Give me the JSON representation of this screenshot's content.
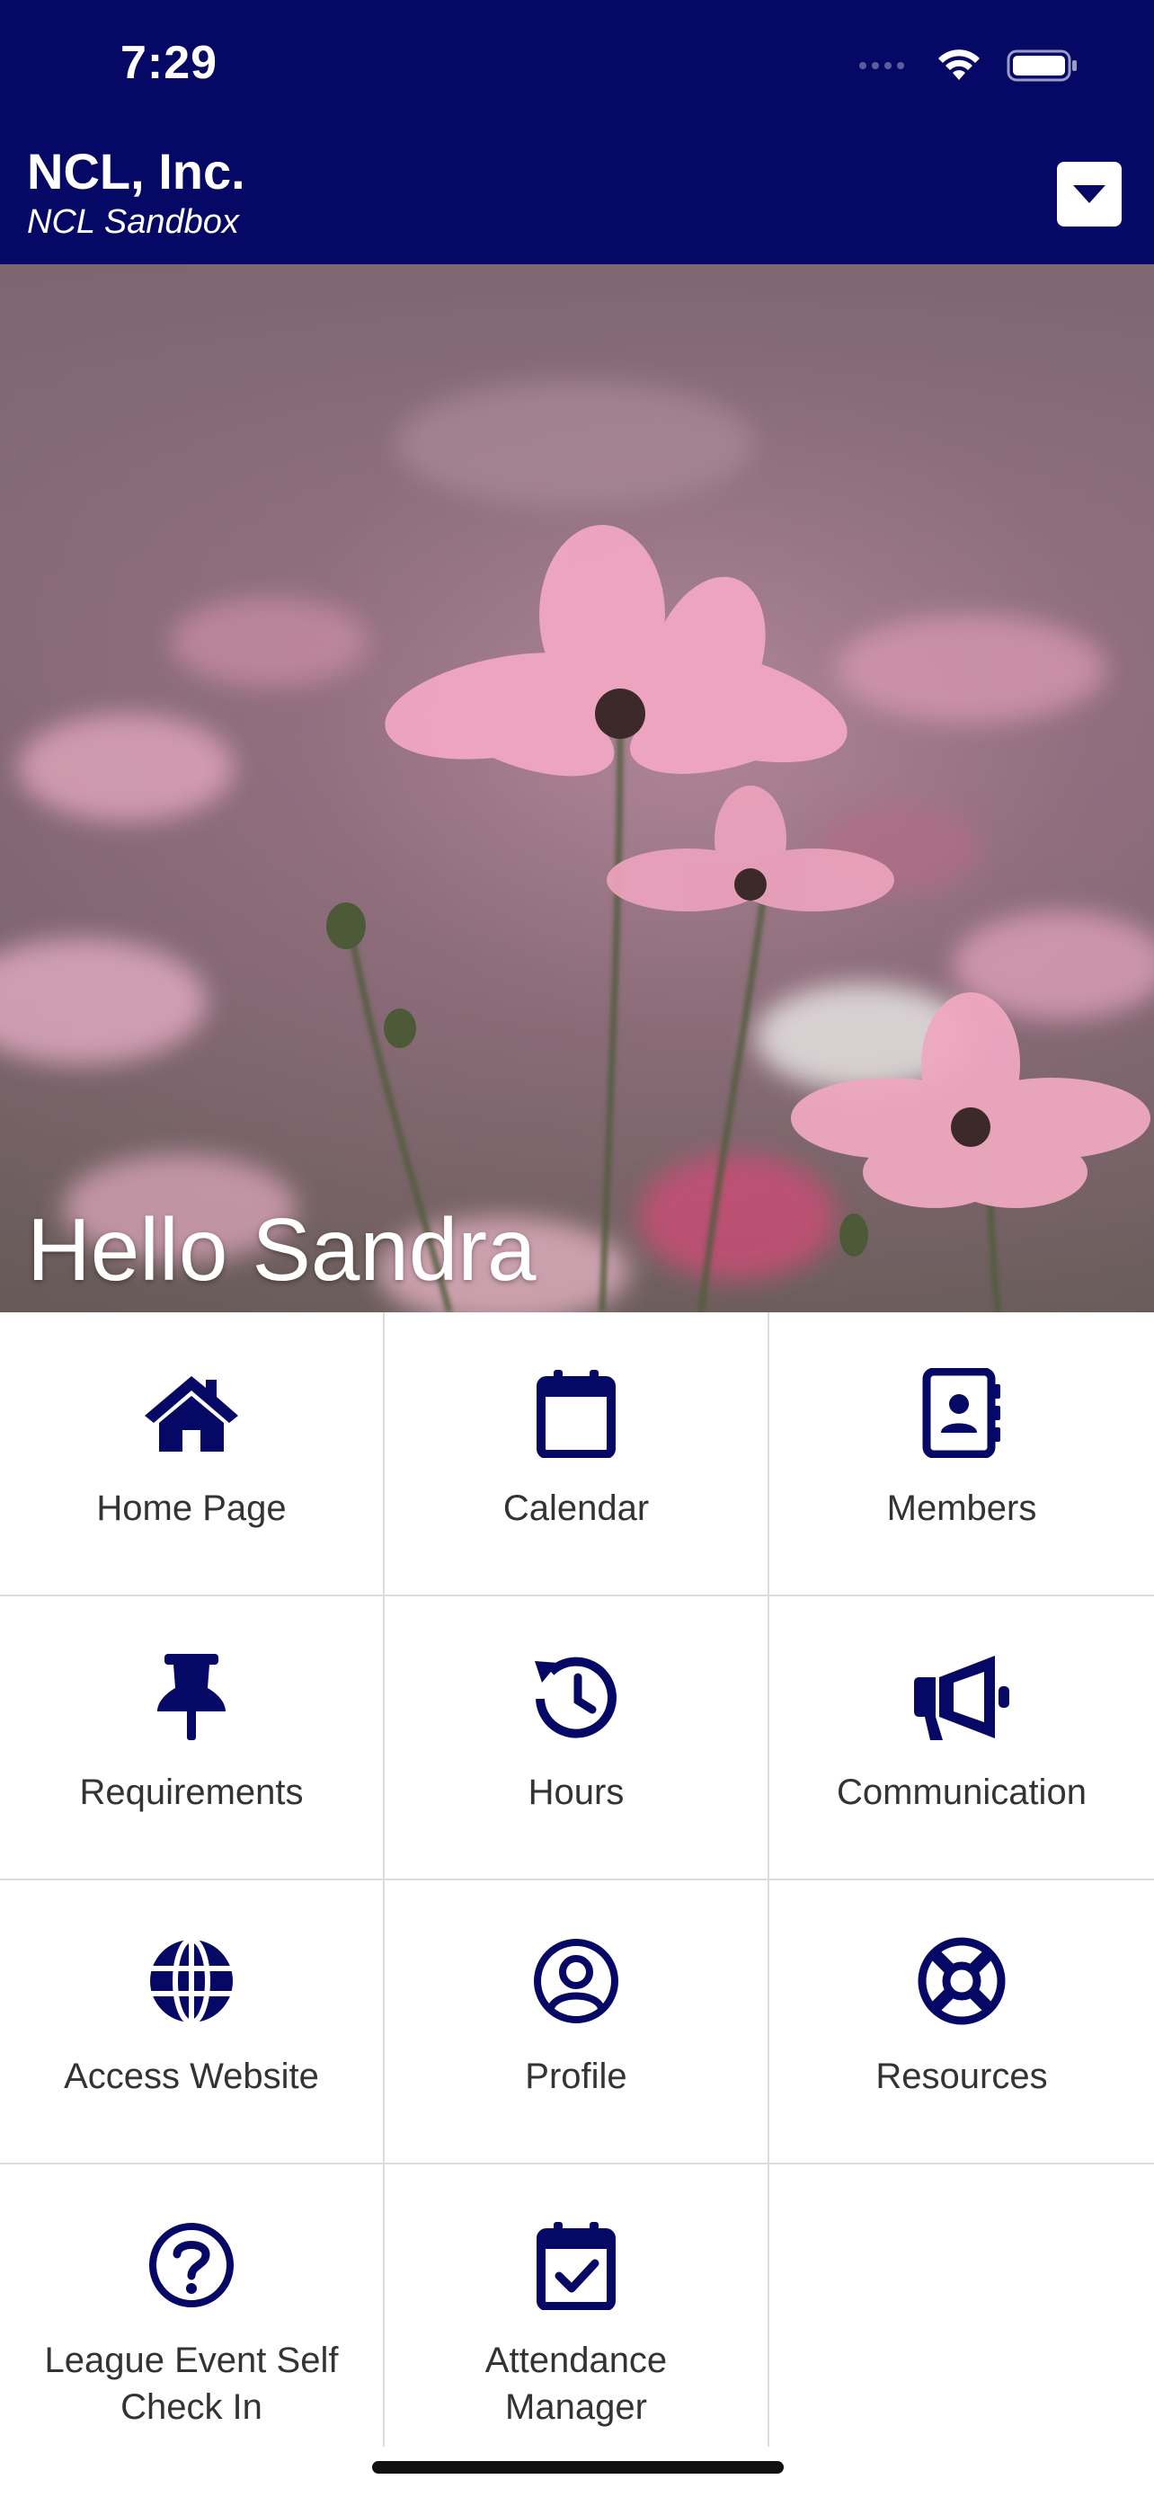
{
  "status_bar": {
    "time": "7:29"
  },
  "header": {
    "org_name": "NCL, Inc.",
    "org_subtitle": "NCL Sandbox"
  },
  "hero": {
    "greeting": "Hello Sandra"
  },
  "tiles": [
    {
      "label": "Home Page",
      "icon": "home-icon"
    },
    {
      "label": "Calendar",
      "icon": "calendar-icon"
    },
    {
      "label": "Members",
      "icon": "address-book-icon"
    },
    {
      "label": "Requirements",
      "icon": "pushpin-icon"
    },
    {
      "label": "Hours",
      "icon": "history-clock-icon"
    },
    {
      "label": "Communication",
      "icon": "megaphone-icon"
    },
    {
      "label": "Access Website",
      "icon": "globe-icon"
    },
    {
      "label": "Profile",
      "icon": "user-circle-icon"
    },
    {
      "label": "Resources",
      "icon": "life-ring-icon"
    },
    {
      "label": "League Event Self Check In",
      "label_lines": [
        "League Event Self",
        "Check In"
      ],
      "icon": "question-circle-icon"
    },
    {
      "label": "Attendance Manager",
      "label_lines": [
        "Attendance",
        "Manager"
      ],
      "icon": "calendar-check-icon"
    }
  ],
  "colors": {
    "header_bg": "#050865",
    "icon_color": "#050865",
    "label_color": "#333333"
  }
}
